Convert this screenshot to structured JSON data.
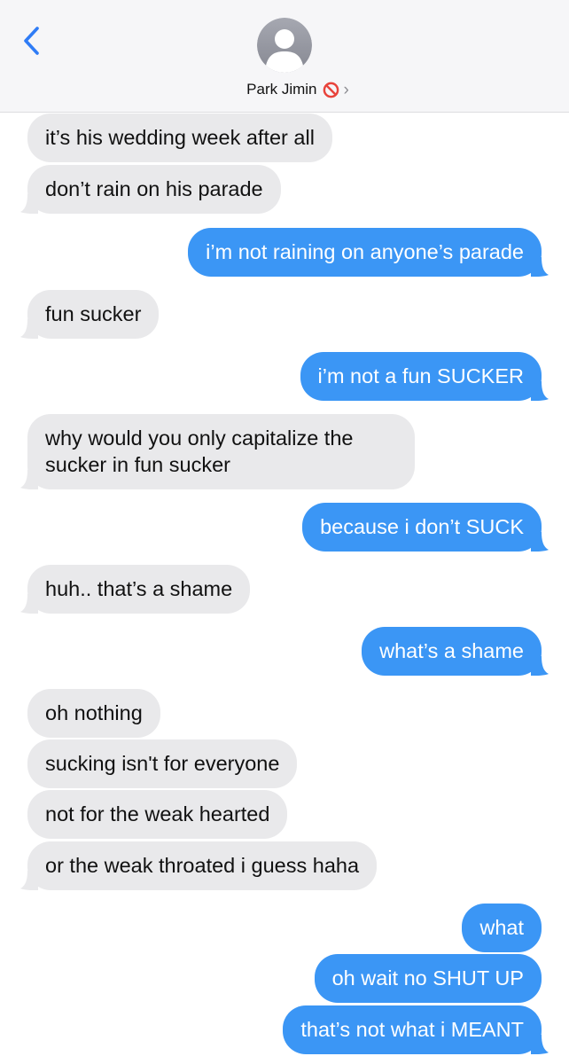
{
  "header": {
    "contact_name": "Park Jimin",
    "status_icon": "prohibited-icon",
    "back_icon": "chevron-left-icon",
    "disclosure_icon": "chevron-right-icon"
  },
  "colors": {
    "incoming_bubble": "#e9e9eb",
    "outgoing_bubble": "#3b96f5",
    "accent": "#2f7cf6"
  },
  "messages": [
    {
      "dir": "in",
      "text": "it’s his wedding week after all"
    },
    {
      "dir": "in",
      "text": "don’t rain on his parade"
    },
    {
      "dir": "out",
      "text": "i’m not raining on anyone’s parade"
    },
    {
      "dir": "in",
      "text": "fun sucker"
    },
    {
      "dir": "out",
      "text": "i’m not a fun SUCKER"
    },
    {
      "dir": "in",
      "text": "why would you only capitalize the sucker in fun sucker"
    },
    {
      "dir": "out",
      "text": "because i don’t SUCK"
    },
    {
      "dir": "in",
      "text": "huh.. that’s a shame"
    },
    {
      "dir": "out",
      "text": "what’s a shame"
    },
    {
      "dir": "in",
      "text": "oh nothing"
    },
    {
      "dir": "in",
      "text": "sucking isn't for everyone"
    },
    {
      "dir": "in",
      "text": "not for the weak hearted"
    },
    {
      "dir": "in",
      "text": "or the weak throated i guess haha"
    },
    {
      "dir": "out",
      "text": "what"
    },
    {
      "dir": "out",
      "text": "oh wait no SHUT UP"
    },
    {
      "dir": "out",
      "text": "that’s not what i MEANT"
    }
  ]
}
